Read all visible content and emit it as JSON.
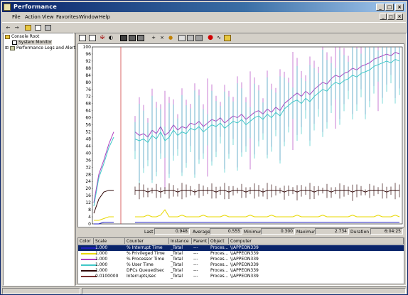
{
  "window": {
    "title": "Performance",
    "controls": [
      "_",
      "□",
      "×"
    ],
    "mdi_controls": [
      "_",
      "□",
      "×"
    ]
  },
  "menu": [
    "File",
    "Action",
    "View",
    "Favorites",
    "Window",
    "Help"
  ],
  "toolbar_icons": [
    "back-icon",
    "forward-icon",
    "up-folder-icon",
    "show-tree-icon",
    "properties-icon"
  ],
  "tree": {
    "root": "Console Root",
    "items": [
      "System Monitor",
      "Performance Logs and Alerts"
    ]
  },
  "monitor_toolbar_icons": [
    "new-counter-set-icon",
    "clear-display-icon",
    "view-current-activity-icon",
    "view-log-data-icon",
    "view-graph-icon",
    "view-histogram-icon",
    "view-report-icon",
    "add-counter-icon",
    "delete-counter-icon",
    "highlight-icon",
    "copy-properties-icon",
    "paste-counter-list-icon",
    "properties-icon",
    "freeze-display-icon",
    "update-data-icon",
    "help-icon"
  ],
  "stats": {
    "last_label": "Last",
    "last": "0.948",
    "average_label": "Average",
    "average": "0.555",
    "minimum_label": "Minimum",
    "minimum": "0.300",
    "maximum_label": "Maximum",
    "maximum": "2.734",
    "duration_label": "Duration",
    "duration": "6:04:25"
  },
  "legend": {
    "headers": [
      "Color",
      "Scale",
      "Counter",
      "Instance",
      "Parent",
      "Object",
      "Computer"
    ],
    "rows": [
      {
        "color": "#2020c0",
        "scale": "1.000",
        "counter": "% Interrupt Time",
        "instance": "_Total",
        "parent": "---",
        "object": "Proces...",
        "computer": "\\\\APPEON339",
        "selected": true
      },
      {
        "color": "#e8d800",
        "scale": "1.000",
        "counter": "% Privileged Time",
        "instance": "_Total",
        "parent": "---",
        "object": "Proces...",
        "computer": "\\\\APPEON339",
        "selected": false
      },
      {
        "color": "#b040c0",
        "scale": "1.000",
        "counter": "% Processor Time",
        "instance": "_Total",
        "parent": "---",
        "object": "Proces...",
        "computer": "\\\\APPEON339",
        "selected": false
      },
      {
        "color": "#40c8c8",
        "scale": "1.000",
        "counter": "% User Time",
        "instance": "_Total",
        "parent": "---",
        "object": "Proces...",
        "computer": "\\\\APPEON339",
        "selected": false
      },
      {
        "color": "#300808",
        "scale": "1.000",
        "counter": "DPCs Queued/sec",
        "instance": "_Total",
        "parent": "---",
        "object": "Proces...",
        "computer": "\\\\APPEON339",
        "selected": false
      },
      {
        "color": "#7a3030",
        "scale": "0.0100000",
        "counter": "Interrupts/sec",
        "instance": "_Total",
        "parent": "---",
        "object": "Proces...",
        "computer": "\\\\APPEON339",
        "selected": false
      }
    ]
  },
  "chart_data": {
    "type": "line",
    "y_ticks": [
      "100",
      "96",
      "92",
      "88",
      "84",
      "80",
      "76",
      "72",
      "68",
      "64",
      "60",
      "56",
      "52",
      "48",
      "44",
      "40",
      "36",
      "32",
      "28",
      "24",
      "20",
      "16",
      "12",
      "8",
      "4",
      "0"
    ],
    "ylim": [
      0,
      100
    ],
    "grid": false,
    "series": [
      {
        "name": "% Processor Time",
        "color": "#b040c0",
        "start": [
          12,
          28,
          36,
          45,
          52
        ],
        "values": [
          52,
          50,
          51,
          49,
          53,
          51,
          55,
          50,
          52,
          56,
          53,
          55,
          54,
          57,
          56,
          58,
          55,
          57,
          59,
          58,
          60,
          57,
          59,
          61,
          60,
          62,
          59,
          61,
          63,
          64,
          62,
          65,
          63,
          66,
          64,
          68,
          70,
          72,
          74,
          72,
          75,
          73,
          76,
          78,
          80,
          79,
          82,
          84,
          83,
          85,
          86,
          88,
          87,
          89,
          90,
          91,
          93,
          94,
          95,
          96,
          95,
          97,
          96
        ]
      },
      {
        "name": "% User Time",
        "color": "#40c8c8",
        "start": [
          10,
          26,
          34,
          43,
          49
        ],
        "values": [
          48,
          47,
          48,
          46,
          50,
          48,
          52,
          47,
          49,
          53,
          50,
          52,
          51,
          54,
          53,
          55,
          52,
          54,
          56,
          55,
          57,
          54,
          56,
          58,
          57,
          59,
          56,
          58,
          60,
          61,
          59,
          62,
          60,
          63,
          61,
          65,
          67,
          69,
          70,
          68,
          71,
          69,
          72,
          74,
          76,
          75,
          78,
          80,
          79,
          81,
          82,
          84,
          83,
          85,
          86,
          87,
          89,
          90,
          91,
          92,
          91,
          93,
          92
        ]
      },
      {
        "name": "Interrupts/sec",
        "color": "#300808",
        "start": [
          6,
          14,
          18,
          19,
          19
        ],
        "values": [
          19,
          19,
          19,
          18,
          19,
          19,
          18,
          19,
          19,
          19,
          18,
          19,
          19,
          19,
          18,
          19,
          19,
          19,
          19,
          18,
          19,
          19,
          18,
          19,
          19,
          19,
          18,
          19,
          19,
          19,
          18,
          19,
          19,
          19,
          19,
          18,
          19,
          19,
          18,
          19,
          19,
          19,
          18,
          19,
          19,
          19,
          18,
          19,
          19,
          19,
          19,
          18,
          19,
          19,
          18,
          19,
          19,
          19,
          19,
          18,
          19,
          19,
          19
        ]
      },
      {
        "name": "% Privileged Time",
        "color": "#e8d800",
        "start": [
          2,
          2,
          3,
          4,
          4
        ],
        "values": [
          4,
          4,
          4,
          5,
          4,
          4,
          5,
          8,
          4,
          4,
          4,
          5,
          4,
          4,
          4,
          4,
          5,
          4,
          4,
          4,
          4,
          5,
          4,
          4,
          4,
          4,
          4,
          5,
          4,
          4,
          4,
          4,
          5,
          4,
          4,
          4,
          4,
          4,
          5,
          4,
          4,
          4,
          4,
          4,
          5,
          4,
          4,
          4,
          4,
          4,
          4,
          5,
          4,
          4,
          4,
          4,
          4,
          5,
          4,
          4,
          4,
          5,
          4
        ]
      },
      {
        "name": "% Interrupt Time",
        "color": "#2020c0",
        "start": [
          0,
          0,
          1,
          1,
          1
        ],
        "values": [
          1,
          1,
          1,
          1,
          1,
          1,
          1,
          1,
          1,
          1,
          1,
          1,
          1,
          1,
          1,
          1,
          1,
          1,
          1,
          1,
          1,
          1,
          1,
          1,
          1,
          1,
          1,
          1,
          1,
          1,
          1,
          1,
          1,
          1,
          1,
          1,
          1,
          1,
          1,
          1,
          1,
          1,
          1,
          1,
          1,
          1,
          1,
          1,
          1,
          1,
          1,
          1,
          1,
          1,
          1,
          1,
          1,
          1,
          1,
          1,
          1,
          1,
          1
        ]
      }
    ]
  }
}
